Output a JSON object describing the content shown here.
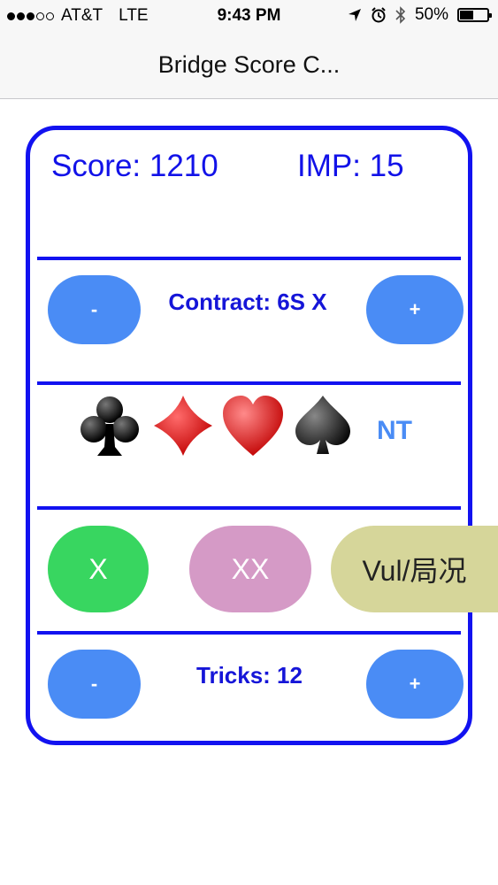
{
  "status_bar": {
    "carrier": "AT&T",
    "network": "LTE",
    "time": "9:43 PM",
    "battery": "50%",
    "battery_level": 0.5
  },
  "nav": {
    "title": "Bridge Score C..."
  },
  "score": {
    "text": "Score: 1210",
    "imp": "IMP: 15"
  },
  "contract": {
    "minus": "-",
    "label": "Contract: 6S X",
    "plus": "+"
  },
  "suits": {
    "nt": "NT"
  },
  "doubling": {
    "x": "X",
    "xx": "XX",
    "vul": "Vul/局况"
  },
  "tricks": {
    "minus": "-",
    "label": "Tricks: 12",
    "plus": "+"
  },
  "colors": {
    "border": "#1212f0",
    "pill_blue": "#4a8cf5",
    "x_green": "#38d660",
    "xx_pink": "#d59ac6",
    "vul_olive": "#d6d69a",
    "diamond_heart_red": "#e01414"
  }
}
